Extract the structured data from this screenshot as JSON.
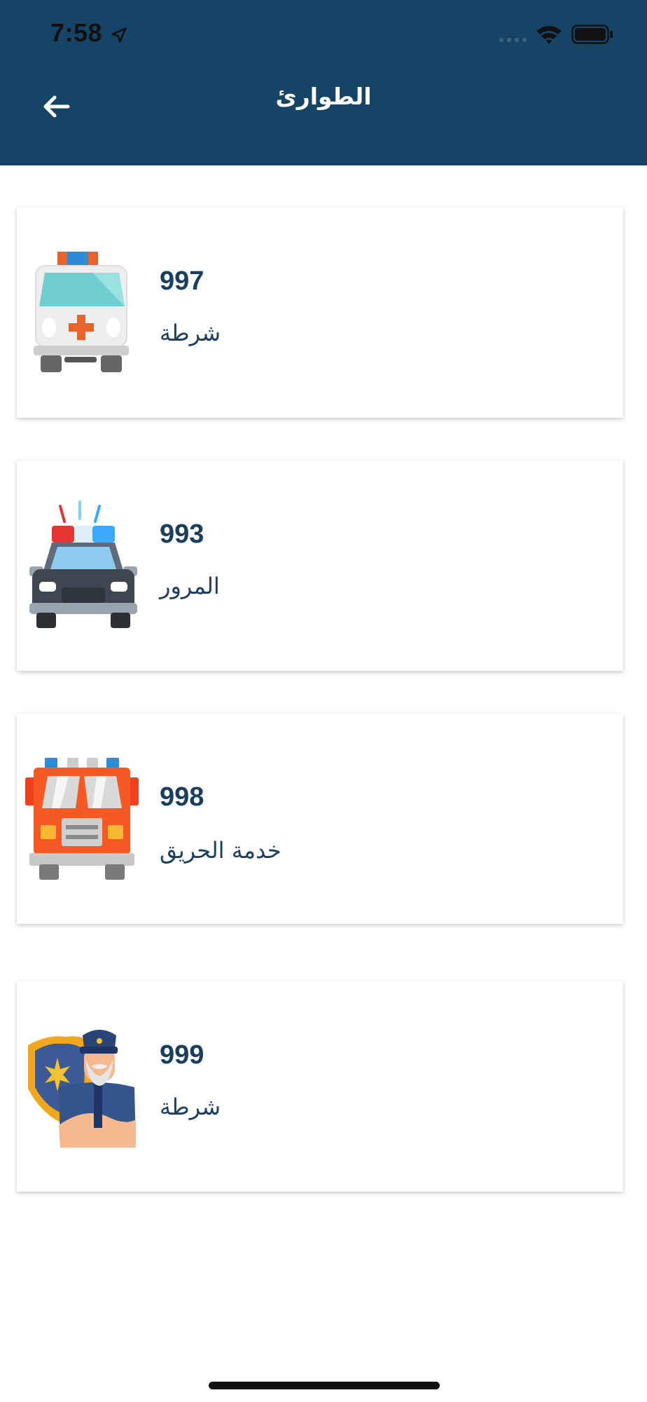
{
  "status_bar": {
    "time": "7:58",
    "icons": [
      "location-arrow-icon",
      "signal-icon",
      "wifi-icon",
      "battery-icon"
    ]
  },
  "header": {
    "title": "الطوارئ",
    "back_icon": "back-arrow-icon",
    "background_color": "#154466"
  },
  "contacts": [
    {
      "number": "997",
      "label": "شرطة",
      "icon": "ambulance-icon"
    },
    {
      "number": "993",
      "label": "المرور",
      "icon": "police-car-icon"
    },
    {
      "number": "998",
      "label": "خدمة الحريق",
      "icon": "fire-truck-icon"
    },
    {
      "number": "999",
      "label": "شرطة",
      "icon": "police-officer-icon"
    }
  ],
  "colors": {
    "text_primary": "#1a3e5e",
    "card_background": "#ffffff"
  }
}
